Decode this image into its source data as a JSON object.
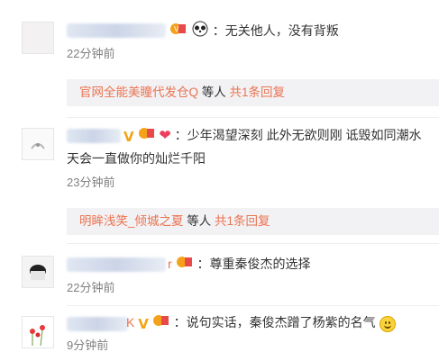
{
  "comments": [
    {
      "text": "：无关他人，没有背叛",
      "time": "22分钟前",
      "reply": {
        "names": "官网全能美瞳代发仓Q",
        "suffix": " 等人 ",
        "count": "共1条回复"
      }
    },
    {
      "text": "：少年渴望深刻 此外无欲则刚 诋毁如同潮水",
      "text2": "天会一直做你的灿烂千阳",
      "time": "23分钟前",
      "reply": {
        "names": "明眸浅笑_倾城之夏",
        "suffix": " 等人 ",
        "count": "共1条回复"
      }
    },
    {
      "name_tail": "r",
      "text": "：尊重秦俊杰的选择",
      "time": "22分钟前"
    },
    {
      "name_tail": "K",
      "text": "：说句实话，秦俊杰蹭了杨紫的名气",
      "time": "9分钟前"
    }
  ],
  "colors": {
    "link": "#eb7350",
    "time": "#808080",
    "reply_bg": "#f2f2f5"
  },
  "icons": [
    "vip-badge-icon",
    "verified-v-icon",
    "panda-icon",
    "heart-icon",
    "smile-icon"
  ]
}
